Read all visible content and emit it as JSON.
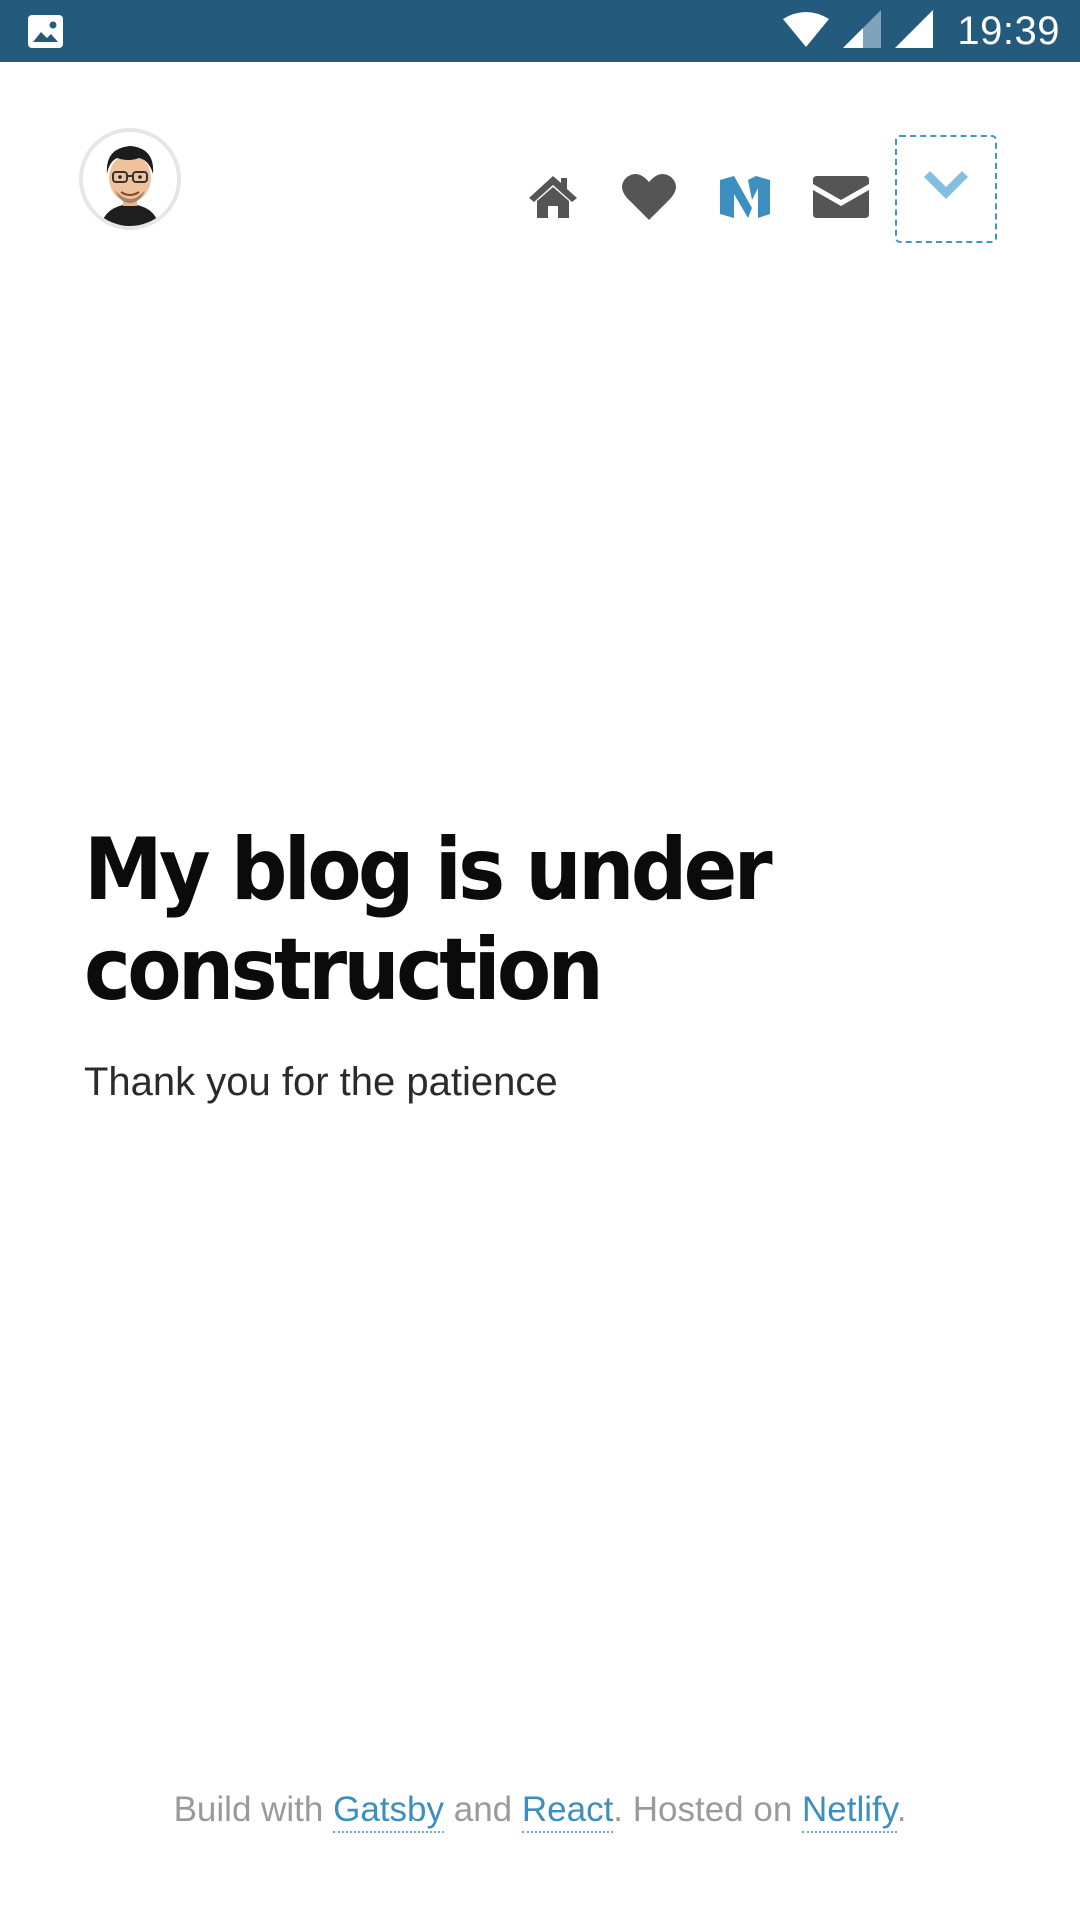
{
  "status_bar": {
    "time": "19:39",
    "icons": [
      "image-icon",
      "wifi-icon",
      "signal-icon",
      "signal-full-icon"
    ]
  },
  "nav": {
    "avatar": "avatar-icon",
    "icons": [
      "home-icon",
      "heart-icon",
      "medium-icon",
      "mail-icon"
    ],
    "menu_toggle": "chevron-down-icon"
  },
  "hero": {
    "title": "My blog is under construction",
    "subtitle": "Thank you for the patience"
  },
  "footer": {
    "text_1": "Build with ",
    "link_gatsby": "Gatsby",
    "text_2": " and ",
    "link_react": "React",
    "text_3": ". Hosted on ",
    "link_netlify": "Netlify",
    "text_4": "."
  },
  "colors": {
    "status_bar": "#245b7c",
    "accent": "#3c8fbf",
    "icon_gray": "#555555",
    "title": "#0b0b0b"
  }
}
